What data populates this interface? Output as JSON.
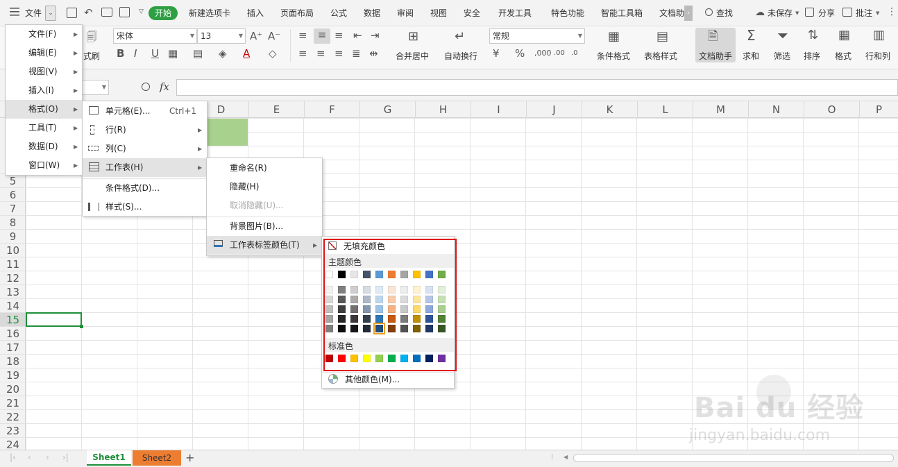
{
  "app_menu": {
    "label": "文件"
  },
  "tabs": [
    {
      "label": "开始",
      "active": true
    },
    {
      "label": "新建选项卡"
    },
    {
      "label": "插入"
    },
    {
      "label": "页面布局"
    },
    {
      "label": "公式"
    },
    {
      "label": "数据"
    },
    {
      "label": "审阅"
    },
    {
      "label": "视图"
    },
    {
      "label": "安全"
    },
    {
      "label": "开发工具"
    },
    {
      "label": "特色功能"
    },
    {
      "label": "智能工具箱"
    },
    {
      "label": "文档助"
    }
  ],
  "topright": {
    "search": "查找",
    "unsaved": "未保存",
    "share": "分享",
    "comment": "批注"
  },
  "ribbon": {
    "format_painter": "式刷",
    "font_name": "宋体",
    "font_size": "13",
    "number_format": "常规",
    "merge": "合并居中",
    "wrap": "自动换行",
    "cond_format": "条件格式",
    "table_style": "表格样式",
    "doc_helper": "文档助手",
    "sum": "求和",
    "filter": "筛选",
    "sort": "排序",
    "format": "格式",
    "rowcol": "行和列"
  },
  "formula_bar": {
    "fx": "fx"
  },
  "columns": [
    "D",
    "E",
    "F",
    "G",
    "H",
    "I",
    "J",
    "K",
    "L",
    "M",
    "N",
    "O",
    "P"
  ],
  "rows": [
    "5",
    "6",
    "7",
    "8",
    "9",
    "10",
    "11",
    "12",
    "13",
    "14",
    "15",
    "16",
    "17",
    "18",
    "19",
    "20",
    "21",
    "22",
    "23",
    "24"
  ],
  "file_menu": {
    "items": [
      {
        "label": "文件(F)"
      },
      {
        "label": "编辑(E)"
      },
      {
        "label": "视图(V)"
      },
      {
        "label": "插入(I)"
      },
      {
        "label": "格式(O)",
        "highlighted": true
      },
      {
        "label": "工具(T)"
      },
      {
        "label": "数据(D)"
      },
      {
        "label": "窗口(W)"
      }
    ]
  },
  "format_menu": {
    "items": [
      {
        "label": "单元格(E)...",
        "shortcut": "Ctrl+1"
      },
      {
        "label": "行(R)"
      },
      {
        "label": "列(C)"
      },
      {
        "label": "工作表(H)",
        "highlighted": true
      },
      {
        "label": "条件格式(D)..."
      },
      {
        "label": "样式(S)..."
      }
    ]
  },
  "sheet_menu": {
    "items": [
      {
        "label": "重命名(R)"
      },
      {
        "label": "隐藏(H)"
      },
      {
        "label": "取消隐藏(U)...",
        "disabled": true
      },
      {
        "label": "背景图片(B)..."
      },
      {
        "label": "工作表标签颜色(T)",
        "highlighted": true
      }
    ]
  },
  "color_picker": {
    "no_fill": "无填充颜色",
    "theme_title": "主题颜色",
    "standard_title": "标准色",
    "more": "其他颜色(M)...",
    "theme_top": [
      "#ffffff",
      "#000000",
      "#e7e6e6",
      "#44546a",
      "#5b9bd5",
      "#ed7d31",
      "#a5a5a5",
      "#ffc000",
      "#4472c4",
      "#70ad47"
    ],
    "theme_shades": [
      [
        "#f2f2f2",
        "#7f7f7f",
        "#d0cece",
        "#d6dce4",
        "#deebf6",
        "#fbe5d5",
        "#ededed",
        "#fff2cc",
        "#d9e2f3",
        "#e2efd9"
      ],
      [
        "#d8d8d8",
        "#595959",
        "#aeabab",
        "#adb9ca",
        "#bdd7ee",
        "#f7cbac",
        "#dbdbdb",
        "#fee599",
        "#b4c6e7",
        "#c5e0b3"
      ],
      [
        "#bfbfbf",
        "#3f3f3f",
        "#757070",
        "#8496b0",
        "#9cc3e5",
        "#f4b183",
        "#c9c9c9",
        "#ffd965",
        "#8eaadb",
        "#a8d08d"
      ],
      [
        "#a5a5a5",
        "#262626",
        "#3a3838",
        "#323f4f",
        "#2e75b5",
        "#c55a11",
        "#7b7b7b",
        "#bf9000",
        "#2f5496",
        "#538135"
      ],
      [
        "#7f7f7f",
        "#0c0c0c",
        "#171616",
        "#222a35",
        "#1e4e79",
        "#833c0b",
        "#525252",
        "#7f6000",
        "#1f3864",
        "#375623"
      ]
    ],
    "standard": [
      "#c00000",
      "#ff0000",
      "#ffc000",
      "#ffff00",
      "#92d050",
      "#00b050",
      "#00b0f0",
      "#0070c0",
      "#002060",
      "#7030a0"
    ],
    "selected": "#1e4e79",
    "highlight_border": "#e01010"
  },
  "sheets": [
    {
      "label": "Sheet1",
      "active": true,
      "color": "#ffffff"
    },
    {
      "label": "Sheet2",
      "active": false,
      "color": "#ed7d31"
    }
  ],
  "watermark": {
    "logo": "Bai du 经验",
    "url": "jingyan.baidu.com"
  },
  "colors": {
    "accent_green": "#2ea043",
    "cell_fill": "#a9d18e",
    "selection": "#1f8f3a"
  }
}
